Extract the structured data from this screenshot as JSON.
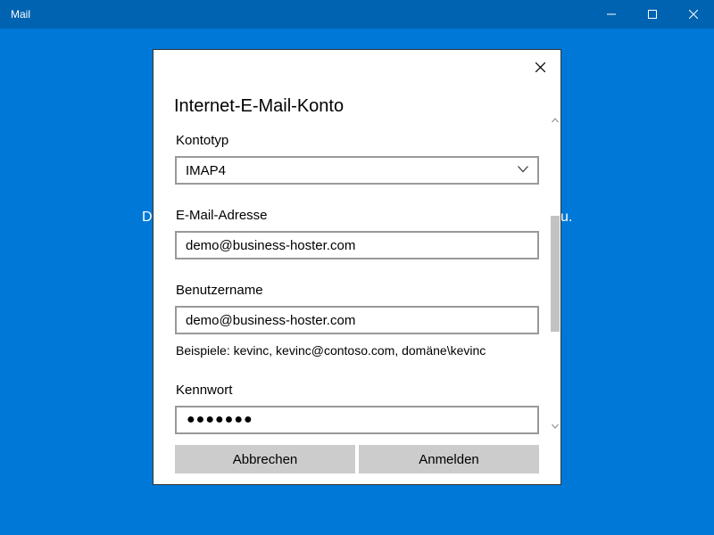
{
  "window": {
    "title": "Mail"
  },
  "background": {
    "text_left": "D",
    "text_right": "u."
  },
  "dialog": {
    "title": "Internet-E-Mail-Konto",
    "account_type": {
      "label": "Kontotyp",
      "value": "IMAP4"
    },
    "email": {
      "label": "E-Mail-Adresse",
      "value": "demo@business-hoster.com"
    },
    "username": {
      "label": "Benutzername",
      "value": "demo@business-hoster.com",
      "hint": "Beispiele: kevinc, kevinc@contoso.com, domäne\\kevinc"
    },
    "password": {
      "label": "Kennwort",
      "masked_value": "●●●●●●●"
    },
    "buttons": {
      "cancel": "Abbrechen",
      "sign_in": "Anmelden"
    }
  },
  "colors": {
    "background": "#0078d7",
    "titlebar": "#0063b1",
    "button": "#cccccc",
    "field_border": "#999999"
  },
  "icons": [
    "minimize-icon",
    "maximize-icon",
    "close-icon",
    "chevron-down-icon",
    "scroll-up-icon",
    "scroll-down-icon"
  ]
}
